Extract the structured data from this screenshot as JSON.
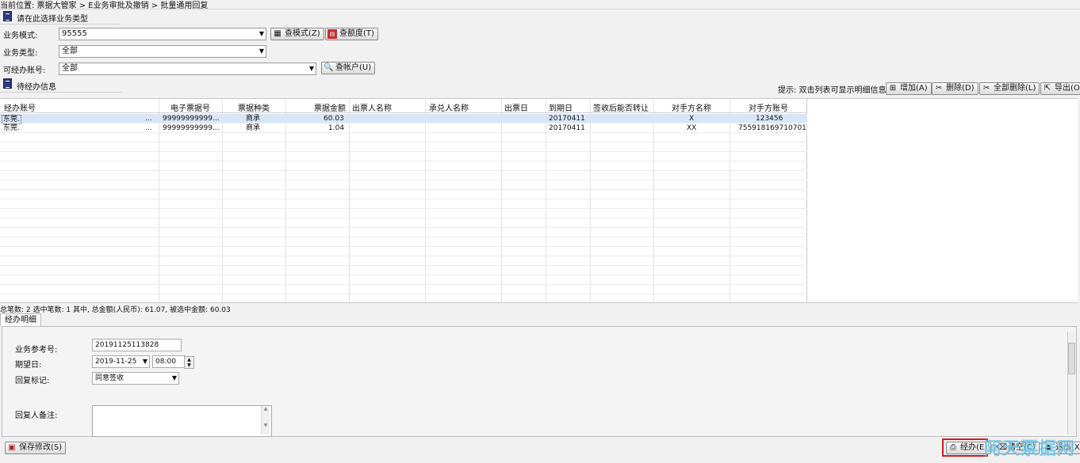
{
  "breadcrumb": "当前位置: 票据大管家 > E业务审批及撤销 > 批量通用回复",
  "section_select_type": {
    "title": "请在此选择业务类型"
  },
  "form": {
    "mode_label": "业务模式:",
    "mode_value": "95555",
    "type_label": "业务类型:",
    "type_value": "全部",
    "account_label": "可经办账号:",
    "account_value": "全部",
    "btn_query_mode": "查模式(Z)",
    "btn_query_quota": "查额度(T)",
    "btn_query_account": "查帐户(U)"
  },
  "section_pending": {
    "title": "待经办信息"
  },
  "toolbar": {
    "hint": "提示: 双击列表可显示明细信息",
    "add": "增加(A)",
    "delete": "删除(D)",
    "delete_all": "全部删除(L)",
    "export": "导出(O)"
  },
  "table": {
    "columns": [
      "经办账号",
      "电子票据号",
      "票据种类",
      "票据金额",
      "出票人名称",
      "承兑人名称",
      "出票日",
      "到期日",
      "签收后能否转让",
      "对手方名称",
      "对手方账号"
    ],
    "rows": [
      {
        "account": "东莞.",
        "dots": "...",
        "bill_no": "99999999999...",
        "kind": "商承",
        "amount": "60.03",
        "drawer": "",
        "acceptor": "",
        "issue_date": "",
        "due_date": "20170411",
        "transferable": "",
        "counterparty": "X",
        "cp_account": "123456"
      },
      {
        "account": "东莞.",
        "dots": "...",
        "bill_no": "99999999999...",
        "kind": "商承",
        "amount": "1.04",
        "drawer": "",
        "acceptor": "",
        "issue_date": "",
        "due_date": "20170411",
        "transferable": "",
        "counterparty": "XX",
        "cp_account": "755918169710701"
      }
    ]
  },
  "summary": "总笔数: 2   选中笔数: 1   其中, 总金额(人民币): 61.07, 被选中金额: 60.03",
  "detail_tab": "经办明细",
  "detail": {
    "ref_label": "业务参考号:",
    "ref_value": "20191125113828",
    "date_label": "期望日:",
    "date_value": "2019-11-25",
    "time_value": "08:00",
    "reply_label": "回复标记:",
    "reply_value": "同意签收",
    "remark_label": "回复人备注:",
    "remark_value": ""
  },
  "bottom": {
    "save": "保存修改(S)",
    "process": "经办(E)",
    "clear": "清空(C)",
    "exit": "退出(X)"
  },
  "watermark": "阿天票据网",
  "colors": {
    "accent_red": "#d01c1c",
    "selection": "#d9e6f7",
    "watermark": "#6ec6e8"
  }
}
